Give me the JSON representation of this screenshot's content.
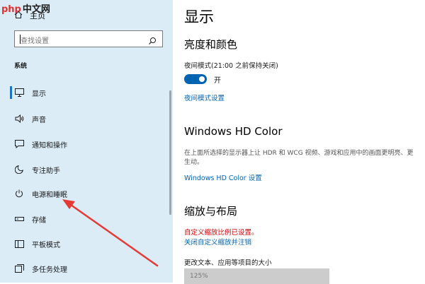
{
  "watermark": {
    "part1": "php",
    "part2": "中文网"
  },
  "sidebar": {
    "home_label": "主页",
    "search": {
      "placeholder": "查找设置"
    },
    "section_label": "系统",
    "items": [
      {
        "label": "显示",
        "icon": "monitor-icon",
        "selected": true
      },
      {
        "label": "声音",
        "icon": "speaker-icon"
      },
      {
        "label": "通知和操作",
        "icon": "notification-icon"
      },
      {
        "label": "专注助手",
        "icon": "moon-icon"
      },
      {
        "label": "电源和睡眠",
        "icon": "power-icon"
      },
      {
        "label": "存储",
        "icon": "storage-icon"
      },
      {
        "label": "平板模式",
        "icon": "tablet-icon"
      },
      {
        "label": "多任务处理",
        "icon": "multitask-icon"
      }
    ]
  },
  "main": {
    "title": "显示",
    "brightness": {
      "heading": "亮度和颜色",
      "night_light_label": "夜间模式(21:00 之前保持关闭)",
      "toggle_state": "开",
      "toggle_on": true,
      "night_light_settings_link": "夜间模式设置"
    },
    "hd_color": {
      "heading": "Windows HD Color",
      "description": "在上面所选择的显示器上让 HDR 和 WCG 视频、游戏和应用中的画面更明亮、更生动。",
      "settings_link": "Windows HD Color 设置"
    },
    "scale": {
      "heading": "缩放与布局",
      "warning": "自定义缩放比例已设置。",
      "disable_link": "关闭自定义缩放并注销",
      "size_label": "更改文本、应用等项目的大小",
      "size_value": "125%"
    }
  },
  "colors": {
    "sidebar_bg": "#dcecf6",
    "accent": "#0063b1",
    "warning": "#d70000",
    "annotation_arrow": "#e53935"
  }
}
